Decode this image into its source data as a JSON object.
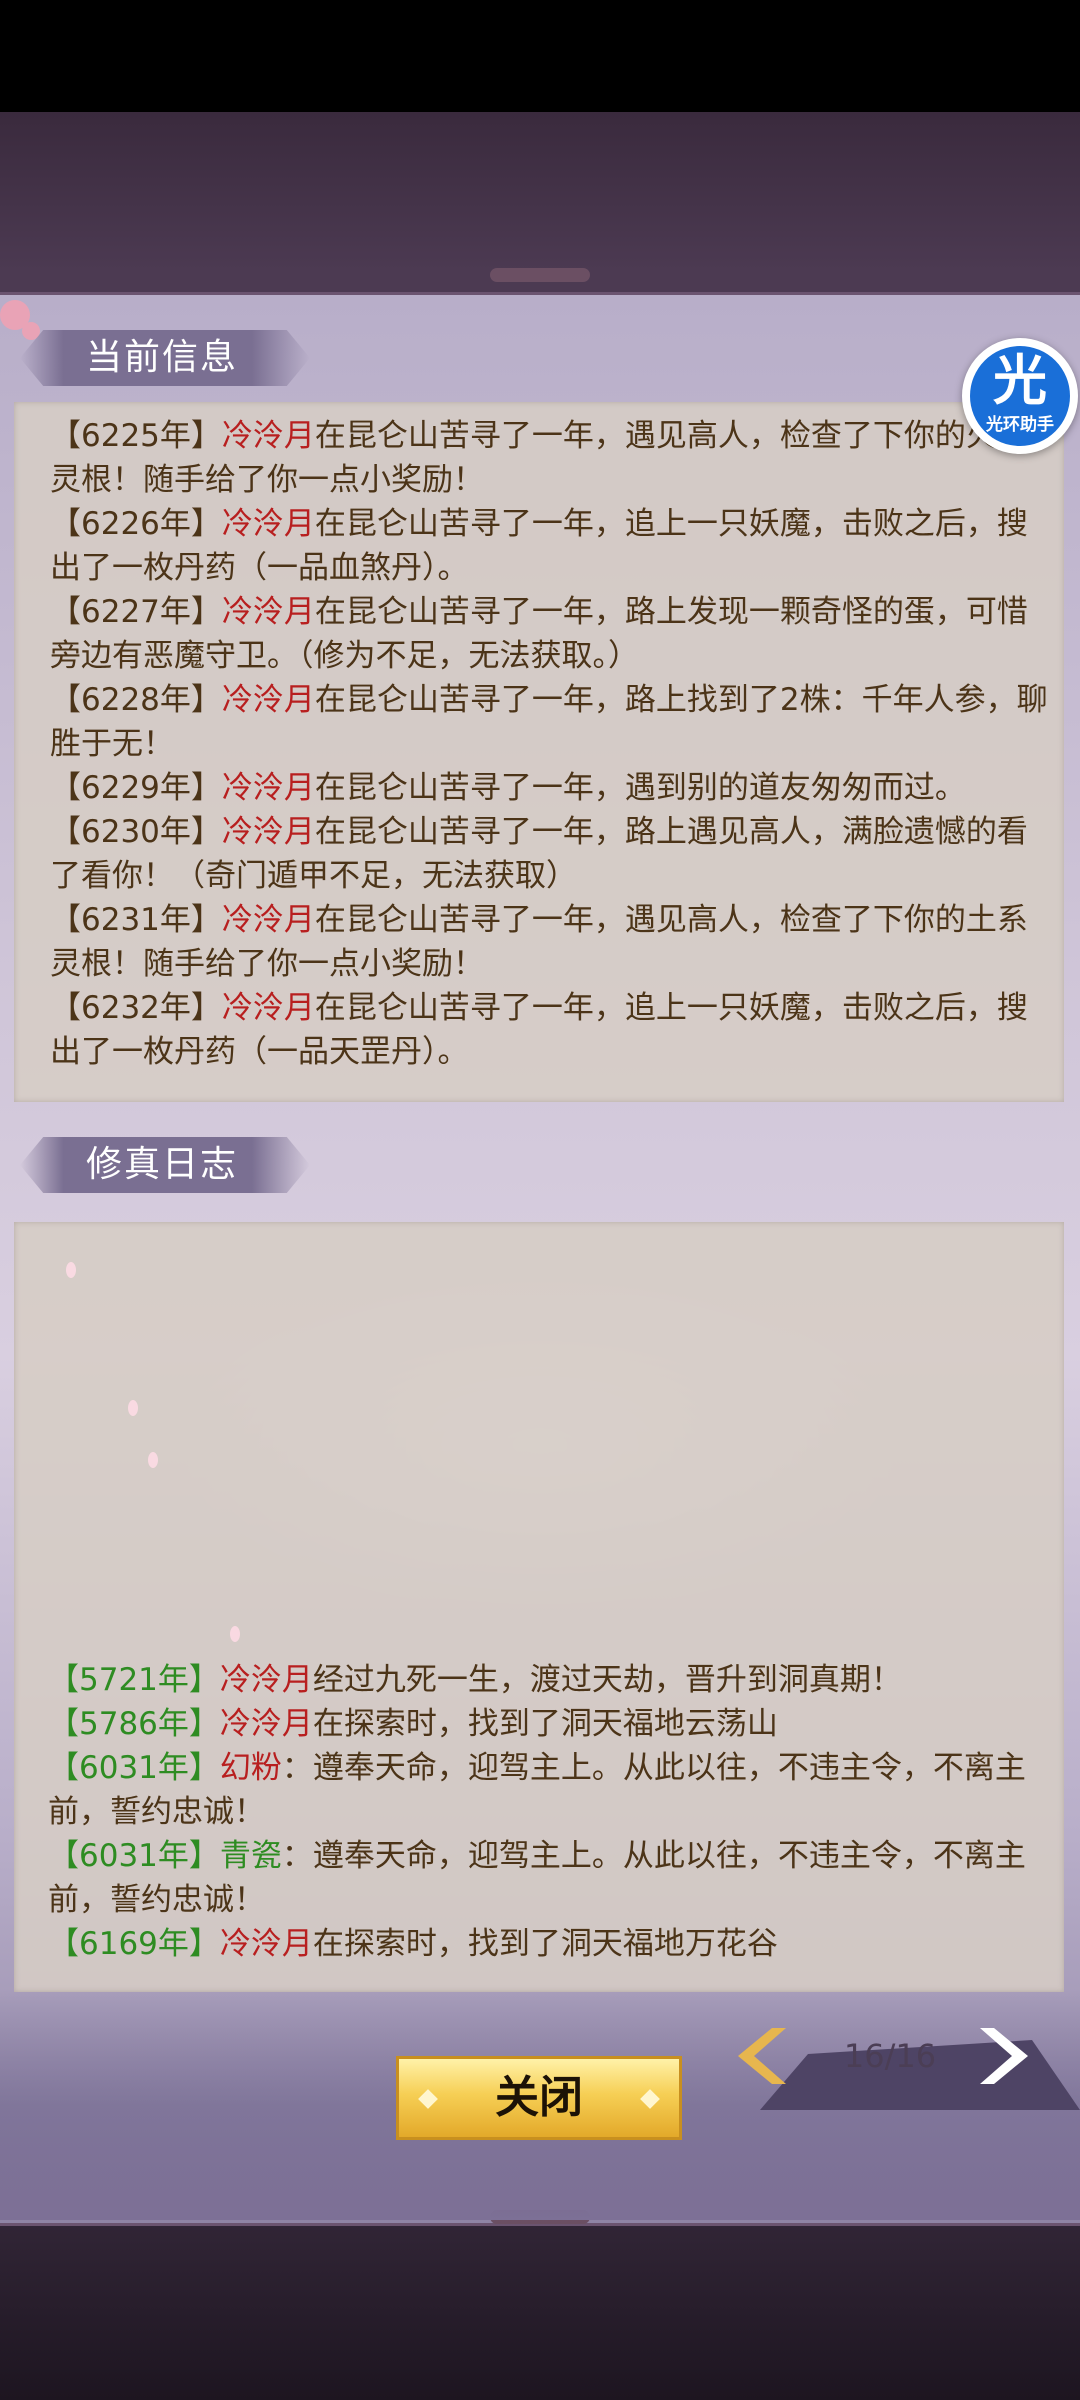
{
  "helper_badge": {
    "glyph": "光",
    "label": "光环助手"
  },
  "current_info": {
    "title": "当前信息",
    "entries": [
      {
        "year": "【6225年】",
        "name": "冷泠月",
        "text": "在昆仑山苦寻了一年，遇见高人，检查了下你的火系灵根！随手给了你一点小奖励！"
      },
      {
        "year": "【6226年】",
        "name": "冷泠月",
        "text": "在昆仑山苦寻了一年，追上一只妖魔，击败之后，搜出了一枚丹药（一品血煞丹）。"
      },
      {
        "year": "【6227年】",
        "name": "冷泠月",
        "text": "在昆仑山苦寻了一年，路上发现一颗奇怪的蛋，可惜旁边有恶魔守卫。（修为不足，无法获取。）"
      },
      {
        "year": "【6228年】",
        "name": "冷泠月",
        "text": "在昆仑山苦寻了一年，路上找到了2株：千年人参，聊胜于无！"
      },
      {
        "year": "【6229年】",
        "name": "冷泠月",
        "text": "在昆仑山苦寻了一年，遇到别的道友匆匆而过。"
      },
      {
        "year": "【6230年】",
        "name": "冷泠月",
        "text": "在昆仑山苦寻了一年，路上遇见高人，满脸遗憾的看了看你！（奇门遁甲不足，无法获取）"
      },
      {
        "year": "【6231年】",
        "name": "冷泠月",
        "text": "在昆仑山苦寻了一年，遇见高人，检查了下你的土系灵根！随手给了你一点小奖励！"
      },
      {
        "year": "【6232年】",
        "name": "冷泠月",
        "text": "在昆仑山苦寻了一年，追上一只妖魔，击败之后，搜出了一枚丹药（一品天罡丹）。"
      }
    ]
  },
  "cultivation_log": {
    "title": "修真日志",
    "entries": [
      {
        "year": "【5721年】",
        "name": "冷泠月",
        "name_color": "red",
        "text": "经过九死一生，渡过天劫，晋升到洞真期！"
      },
      {
        "year": "【5786年】",
        "name": "冷泠月",
        "name_color": "red",
        "text": "在探索时，找到了洞天福地云荡山"
      },
      {
        "year": "【6031年】",
        "name": "幻粉",
        "name_color": "red",
        "text": "：遵奉天命，迎驾主上。从此以往，不违主令，不离主前，誓约忠诚！"
      },
      {
        "year": "【6031年】",
        "name": "青瓷",
        "name_color": "green",
        "text": "：遵奉天命，迎驾主上。从此以往，不违主令，不离主前，誓约忠诚！"
      },
      {
        "year": "【6169年】",
        "name": "冷泠月",
        "name_color": "red",
        "text": "在探索时，找到了洞天福地万花谷"
      }
    ]
  },
  "controls": {
    "close_label": "关闭",
    "page_indicator": "16/16"
  },
  "colors": {
    "year_brown": "#4c3418",
    "year_green": "#2e8c22",
    "name_red": "#b81f1f",
    "name_green": "#2e8c22",
    "close_gold": "#f6cf55",
    "nav_arrow": "#e7b64e",
    "helper_blue": "#1a6fd8"
  }
}
